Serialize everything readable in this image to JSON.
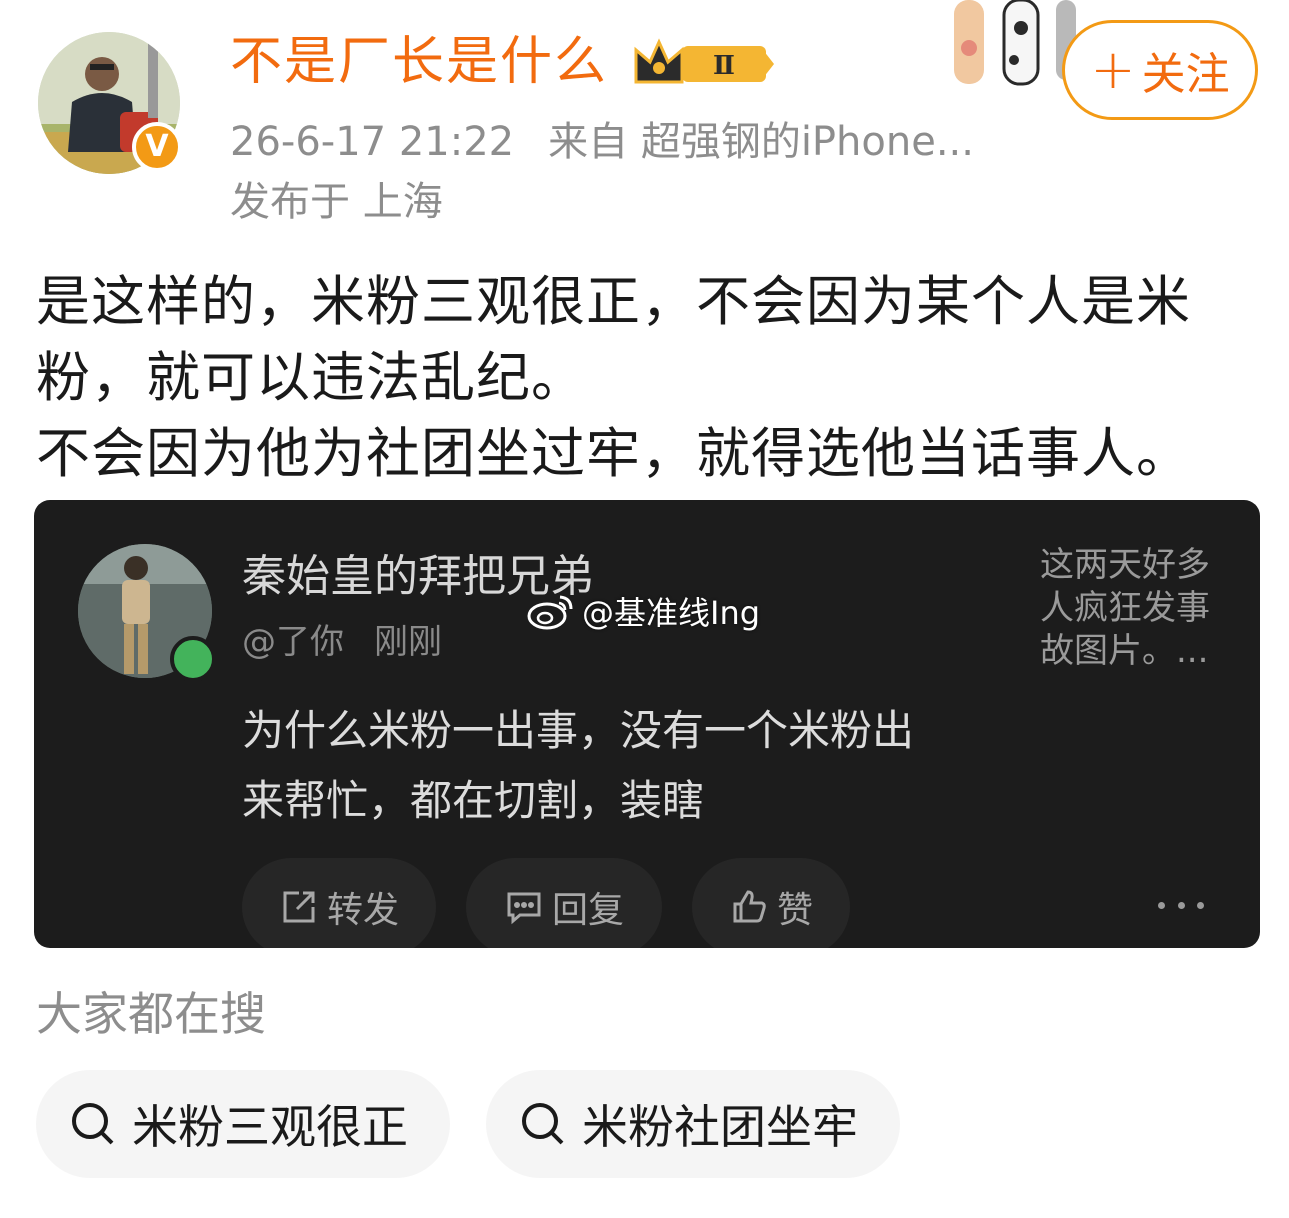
{
  "post": {
    "username": "不是厂长是什么",
    "level_badge": "Ⅱ",
    "timestamp": "26-6-17 21:22",
    "source": "来自 超强钢的iPhone...",
    "location": "发布于 上海",
    "follow_label": "关注",
    "text_lines": [
      "是这样的，米粉三观很正，不会因为某个人是米",
      "粉，就可以违法乱纪。",
      "不会因为他为社团坐过牢，就得选他当话事人。"
    ]
  },
  "embed": {
    "name": "秦始皇的拜把兄弟",
    "handle": "@了你",
    "time": "刚刚",
    "side_text_lines": [
      "这两天好多",
      "人疯狂发事",
      "故图片。..."
    ],
    "content_lines": [
      "为什么米粉一出事，没有一个米粉出",
      "来帮忙，都在切割，装瞎"
    ],
    "actions": {
      "repost": "转发",
      "reply": "回复",
      "like": "赞"
    }
  },
  "watermark": "@基准线Ing",
  "search": {
    "title": "大家都在搜",
    "chips": [
      "米粉三观很正",
      "米粉社团坐牢"
    ]
  },
  "colors": {
    "username": "#f26b0f",
    "follow_border": "#f39a15",
    "verified_badge": "#f39a15",
    "embed_bg": "#1c1c1c",
    "online_dot": "#43b35b"
  },
  "icons": [
    "verified-badge-icon",
    "crown-level-icon",
    "plus-icon",
    "repost-icon",
    "comment-icon",
    "thumbs-up-icon",
    "more-icon",
    "weibo-logo-icon",
    "search-icon"
  ]
}
